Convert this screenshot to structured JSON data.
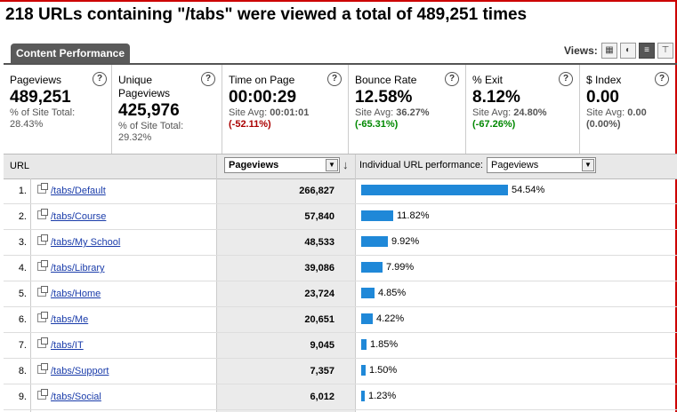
{
  "headline": "218 URLs containing \"/tabs\" were viewed a total of 489,251 times",
  "tab_label": "Content Performance",
  "views": {
    "label": "Views:",
    "icons": [
      "grid-view-icon",
      "pie-view-icon",
      "performance-view-icon",
      "comparison-view-icon"
    ],
    "active": "performance-view-icon"
  },
  "metrics": [
    {
      "label": "Pageviews",
      "value": "489,251",
      "sub1": "% of Site Total:",
      "sub2": "28.43%"
    },
    {
      "label": "Unique Pageviews",
      "value": "425,976",
      "sub1": "% of Site Total:",
      "sub2": "29.32%"
    },
    {
      "label": "Time on Page",
      "value": "00:00:29",
      "sub1": "Site Avg:",
      "avg": "00:01:01",
      "pct": "(-52.11%)"
    },
    {
      "label": "Bounce Rate",
      "value": "12.58%",
      "sub1": "Site Avg:",
      "avg": "36.27%",
      "pct": "(-65.31%)"
    },
    {
      "label": "% Exit",
      "value": "8.12%",
      "sub1": "Site Avg:",
      "avg": "24.80%",
      "pct": "(-67.26%)"
    },
    {
      "label": "$ Index",
      "value": "0.00",
      "sub1": "Site Avg:",
      "avg": "0.00",
      "pct": "(0.00%)"
    }
  ],
  "metric_help": "?",
  "colors": {
    "negative": "#a00000",
    "positive": "#008000",
    "neutral": "#555555",
    "bar": "#1f88d8"
  },
  "table": {
    "url_header": "URL",
    "sort_select": "Pageviews",
    "perf_label": "Individual URL performance:",
    "perf_select": "Pageviews",
    "rows": [
      {
        "num": "1.",
        "url": "/tabs/Default",
        "value": "266,827",
        "pct": "54.54%",
        "share": 54.54
      },
      {
        "num": "2.",
        "url": "/tabs/Course",
        "value": "57,840",
        "pct": "11.82%",
        "share": 11.82
      },
      {
        "num": "3.",
        "url": "/tabs/My School",
        "value": "48,533",
        "pct": "9.92%",
        "share": 9.92
      },
      {
        "num": "4.",
        "url": "/tabs/Library",
        "value": "39,086",
        "pct": "7.99%",
        "share": 7.99
      },
      {
        "num": "5.",
        "url": "/tabs/Home",
        "value": "23,724",
        "pct": "4.85%",
        "share": 4.85
      },
      {
        "num": "6.",
        "url": "/tabs/Me",
        "value": "20,651",
        "pct": "4.22%",
        "share": 4.22
      },
      {
        "num": "7.",
        "url": "/tabs/IT",
        "value": "9,045",
        "pct": "1.85%",
        "share": 1.85
      },
      {
        "num": "8.",
        "url": "/tabs/Support",
        "value": "7,357",
        "pct": "1.50%",
        "share": 1.5
      },
      {
        "num": "9.",
        "url": "/tabs/Social",
        "value": "6,012",
        "pct": "1.23%",
        "share": 1.23
      }
    ]
  }
}
